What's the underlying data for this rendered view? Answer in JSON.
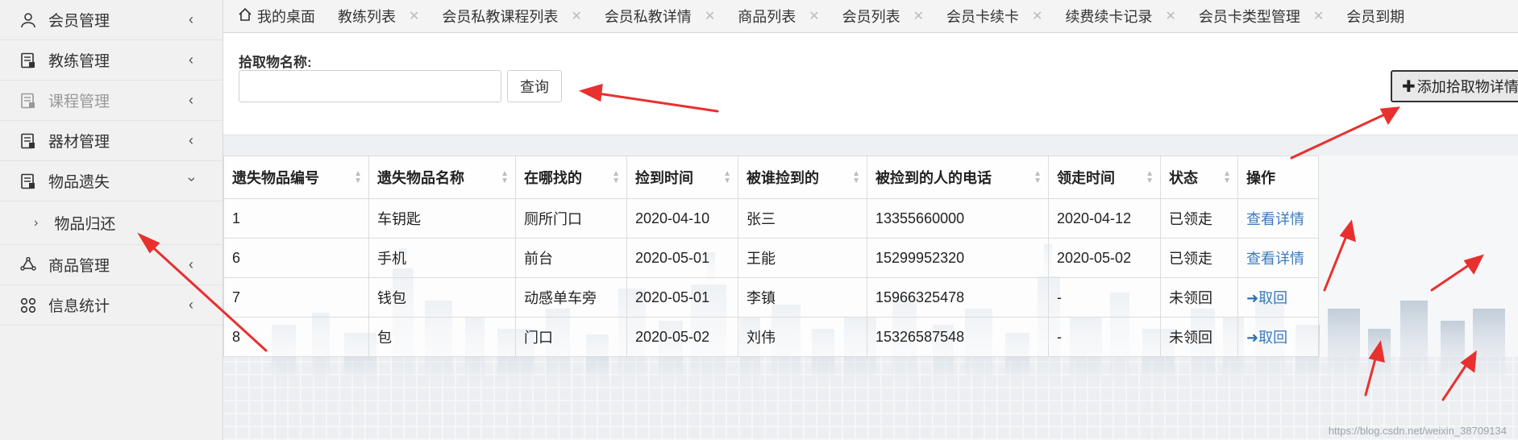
{
  "sidebar": {
    "items": [
      {
        "label": "会员管理",
        "icon": "user-icon",
        "expanded": false
      },
      {
        "label": "教练管理",
        "icon": "document-icon",
        "expanded": false
      },
      {
        "label": "课程管理",
        "icon": "document-icon",
        "expanded": false
      },
      {
        "label": "器材管理",
        "icon": "document-icon",
        "expanded": false
      },
      {
        "label": "物品遗失",
        "icon": "document-icon",
        "expanded": true
      },
      {
        "label": "商品管理",
        "icon": "recycle-icon",
        "expanded": false
      },
      {
        "label": "信息统计",
        "icon": "grid-icon",
        "expanded": false
      }
    ],
    "subitem": {
      "label": "物品归还"
    }
  },
  "tabs": [
    {
      "label": "我的桌面"
    },
    {
      "label": "教练列表"
    },
    {
      "label": "会员私教课程列表"
    },
    {
      "label": "会员私教详情"
    },
    {
      "label": "商品列表"
    },
    {
      "label": "会员列表"
    },
    {
      "label": "会员卡续卡"
    },
    {
      "label": "续费续卡记录"
    },
    {
      "label": "会员卡类型管理"
    },
    {
      "label": "会员到期"
    }
  ],
  "search": {
    "label": "拾取物名称:",
    "placeholder": "",
    "button": "查询",
    "add_button": "添加拾取物详情"
  },
  "table": {
    "headers": [
      "遗失物品编号",
      "遗失物品名称",
      "在哪找的",
      "捡到时间",
      "被谁捡到的",
      "被捡到的人的电话",
      "领走时间",
      "状态",
      "操作"
    ],
    "rows": [
      {
        "id": "1",
        "name": "车钥匙",
        "place": "厕所门口",
        "found": "2020-04-10",
        "finder": "张三",
        "phone": "13355660000",
        "claimed": "2020-04-12",
        "status": "已领走",
        "action": "查看详情",
        "action_type": "view"
      },
      {
        "id": "6",
        "name": "手机",
        "place": "前台",
        "found": "2020-05-01",
        "finder": "王能",
        "phone": "15299952320",
        "claimed": "2020-05-02",
        "status": "已领走",
        "action": "查看详情",
        "action_type": "view"
      },
      {
        "id": "7",
        "name": "钱包",
        "place": "动感单车旁",
        "found": "2020-05-01",
        "finder": "李镇",
        "phone": "15966325478",
        "claimed": "-",
        "status": "未领回",
        "action": "取回",
        "action_type": "retrieve"
      },
      {
        "id": "8",
        "name": "包",
        "place": "门口",
        "found": "2020-05-02",
        "finder": "刘伟",
        "phone": "15326587548",
        "claimed": "-",
        "status": "未领回",
        "action": "取回",
        "action_type": "retrieve"
      }
    ]
  },
  "watermark": "https://blog.csdn.net/weixin_38709134",
  "colors": {
    "link": "#3a7bbf",
    "annotation_arrow": "#e8302f",
    "sidebar_bg": "#f1f1f1"
  }
}
